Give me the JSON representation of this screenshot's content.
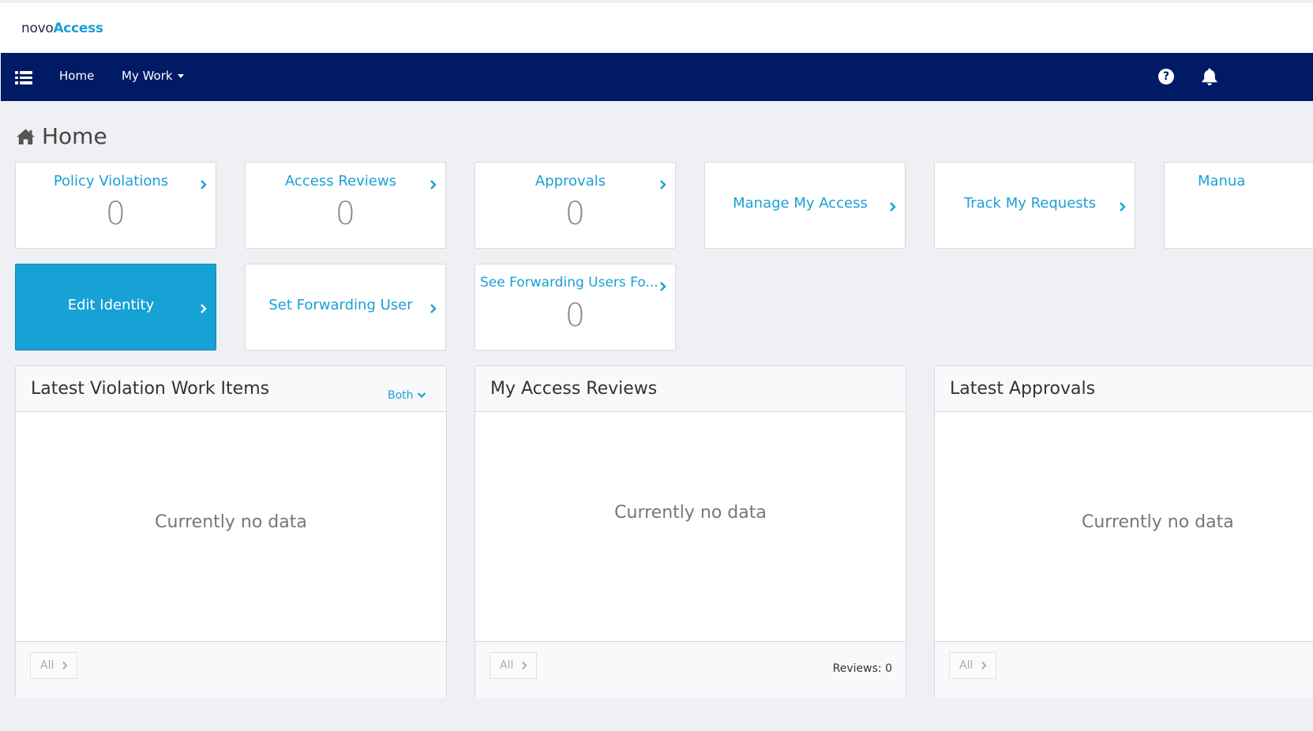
{
  "app": {
    "logo_part1": "novo",
    "logo_part2": "Access"
  },
  "nav": {
    "menu_icon": "list-icon",
    "home": "Home",
    "my_work": "My Work",
    "help_icon": "help-icon",
    "bell_icon": "bell-icon"
  },
  "page": {
    "title": "Home",
    "icon": "home-icon"
  },
  "tiles": [
    {
      "label": "Policy Violations",
      "count": "0"
    },
    {
      "label": "Access Reviews",
      "count": "0"
    },
    {
      "label": "Approvals",
      "count": "0"
    },
    {
      "label": "Manage My Access"
    },
    {
      "label": "Track My Requests"
    },
    {
      "label": "Manua"
    },
    {
      "label": "Edit Identity"
    },
    {
      "label": "Set Forwarding User"
    },
    {
      "label": "See Forwarding Users Fo...",
      "count": "0"
    }
  ],
  "panels": [
    {
      "title": "Latest Violation Work Items",
      "filter": "Both",
      "empty": "Currently no data",
      "all": "All"
    },
    {
      "title": "My Access Reviews",
      "empty": "Currently no data",
      "all": "All",
      "footer_text": "Reviews: 0"
    },
    {
      "title": "Latest Approvals",
      "empty": "Currently no data",
      "all": "All"
    }
  ],
  "colors": {
    "nav_bg": "#001a66",
    "accent": "#1a9fd6",
    "active_tile": "#17a2d6",
    "page_bg": "#eff0f3"
  }
}
